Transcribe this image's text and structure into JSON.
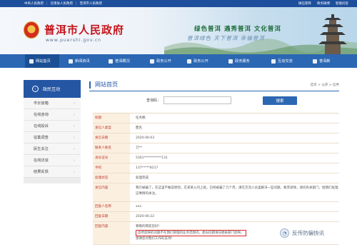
{
  "topbar": {
    "links": [
      "中央人民政府",
      "云南省人民政府",
      "普洱市人民政府"
    ],
    "right": [
      "微信矩阵",
      "政务微博",
      "智能问答"
    ]
  },
  "banner": {
    "title": "普洱市人民政府",
    "url": "www.puershi.gov.cn",
    "slogan1": "绿色普洱 遇秀普洱 文化普洱",
    "slogan2": "普洱绿色 天下普洱 幸福普洱"
  },
  "nav": [
    {
      "label": "网站首页",
      "icon": "home-icon"
    },
    {
      "label": "新闻资讯",
      "icon": "news-icon"
    },
    {
      "label": "普洱概况",
      "icon": "map-icon"
    },
    {
      "label": "政务公开",
      "icon": "doc-icon"
    },
    {
      "label": "政务公开",
      "icon": "doc-icon"
    },
    {
      "label": "政务服务",
      "icon": "service-icon"
    },
    {
      "label": "互动交流",
      "icon": "chat-icon"
    },
    {
      "label": "普洱新",
      "icon": "star-icon"
    }
  ],
  "sidebar": {
    "head": "政民互动",
    "items": [
      "市长信箱",
      "在线咨询",
      "在线投诉",
      "征集调查",
      "民生关注",
      "在线访谈",
      "结果反馈"
    ]
  },
  "content": {
    "heading": "网站首页",
    "breadcrumb": "首页 > 公开 > 信件",
    "search_label": "查询码：",
    "search_button": "搜索",
    "rows": [
      {
        "k": "标题",
        "v": "任务稿"
      },
      {
        "k": "发信人类型",
        "v": "匿名"
      },
      {
        "k": "发信日期",
        "v": "2020-06-03"
      },
      {
        "k": "联系人姓名",
        "v": "刀**"
      },
      {
        "k": "身份证号",
        "v": "5301***********131"
      },
      {
        "k": "手机",
        "v": "137*****8217"
      },
      {
        "k": "处理状态",
        "v": "处理完成"
      },
      {
        "k": "发信内容",
        "v": "我们被骗了，在这里不敢说原因，在某某公司上班，已经被骗了几个月，请在交流人员里解决一些问题，要求退钱，请问有关部门，给我们处理这事情的关注。",
        "tall": true
      },
      {
        "k": "回复人名称",
        "v": "xxx"
      },
      {
        "k": "回复日期",
        "v": "2020-06-22"
      },
      {
        "k": "回复内容",
        "v": "尊敬的网友您好！",
        "v2": "您所反映的问题不在我们管理的业务范围内，类似问题请向相关部门反映。",
        "v3": "感谢您对我们工作的支持！",
        "tall": true
      }
    ]
  },
  "watermark": "反传防骗快讯"
}
